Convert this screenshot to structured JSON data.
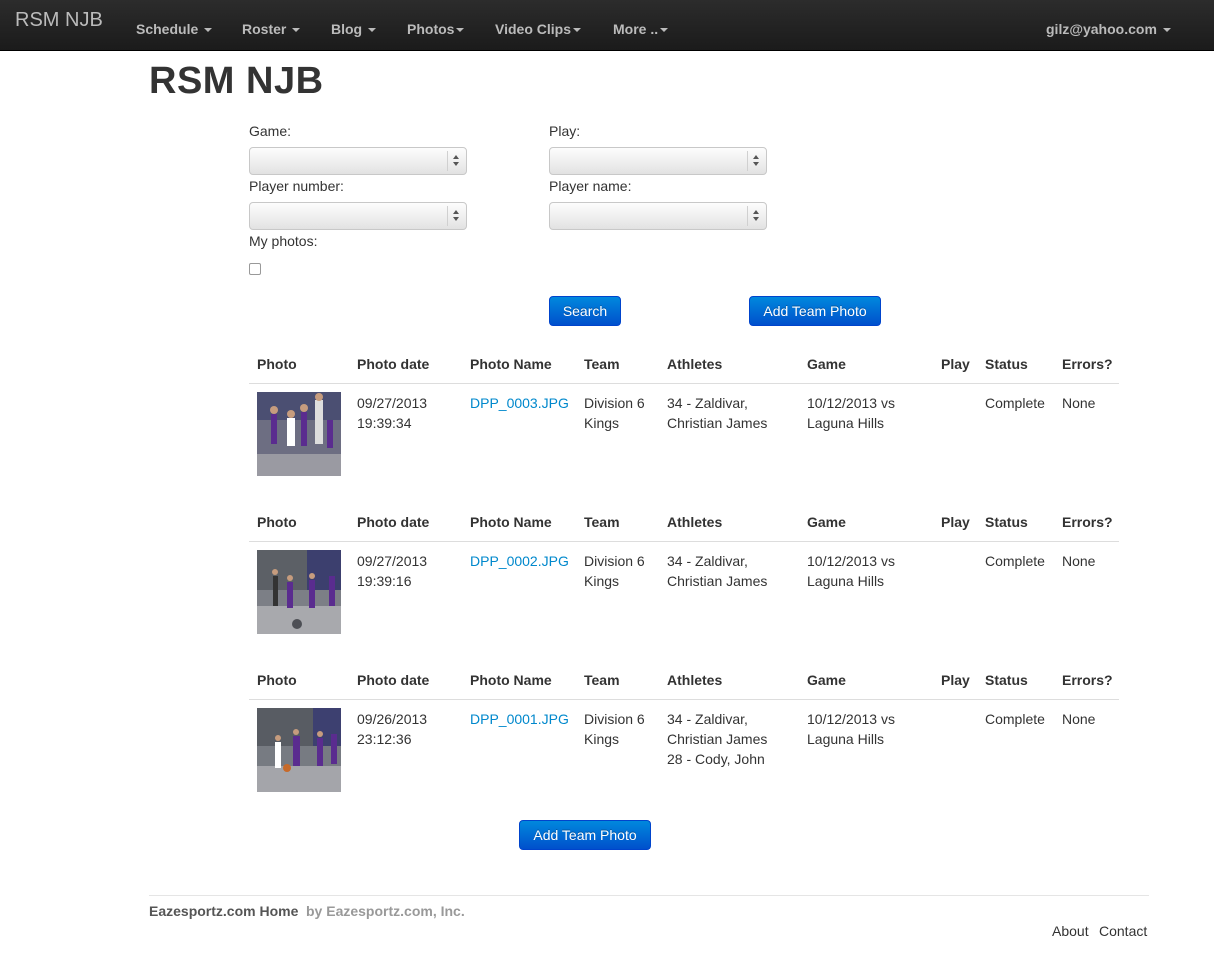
{
  "navbar": {
    "brand": "RSM NJB",
    "items": [
      {
        "label": "Schedule"
      },
      {
        "label": "Roster"
      },
      {
        "label": "Blog"
      },
      {
        "label": "Photos"
      },
      {
        "label": "Video Clips"
      },
      {
        "label": "More .."
      }
    ],
    "user": "gilz@yahoo.com"
  },
  "page_title": "RSM NJB",
  "form": {
    "game_label": "Game:",
    "play_label": "Play:",
    "player_number_label": "Player number:",
    "player_name_label": "Player name:",
    "my_photos_label": "My photos:",
    "my_photos_checked": false,
    "search_button": "Search",
    "add_team_photo_button": "Add Team Photo"
  },
  "columns": [
    "Photo",
    "Photo date",
    "Photo Name",
    "Team",
    "Athletes",
    "Game",
    "Play",
    "Status",
    "Errors?"
  ],
  "photos": [
    {
      "date": [
        "09/27/2013",
        "19:39:34"
      ],
      "name": "DPP_0003.JPG",
      "team": [
        "Division 6",
        "Kings"
      ],
      "athletes": [
        "34 - Zaldivar,",
        "Christian James"
      ],
      "game": [
        "10/12/2013 vs",
        "Laguna Hills"
      ],
      "play": "",
      "status": "Complete",
      "errors": "None"
    },
    {
      "date": [
        "09/27/2013",
        "19:39:16"
      ],
      "name": "DPP_0002.JPG",
      "team": [
        "Division 6",
        "Kings"
      ],
      "athletes": [
        "34 - Zaldivar,",
        "Christian James"
      ],
      "game": [
        "10/12/2013 vs",
        "Laguna Hills"
      ],
      "play": "",
      "status": "Complete",
      "errors": "None"
    },
    {
      "date": [
        "09/26/2013",
        "23:12:36"
      ],
      "name": "DPP_0001.JPG",
      "team": [
        "Division 6",
        "Kings"
      ],
      "athletes": [
        "34 - Zaldivar,",
        "Christian James",
        "28 - Cody, John"
      ],
      "game": [
        "10/12/2013 vs",
        "Laguna Hills"
      ],
      "play": "",
      "status": "Complete",
      "errors": "None"
    }
  ],
  "bottom_button": "Add Team Photo",
  "footer": {
    "home": "Eazesportz.com Home",
    "by": "by Eazesportz.com, Inc.",
    "about": "About",
    "contact": "Contact"
  },
  "colors": {
    "navbar": "#1b1b1b",
    "button": "#0066cc",
    "link": "#0088cc"
  }
}
